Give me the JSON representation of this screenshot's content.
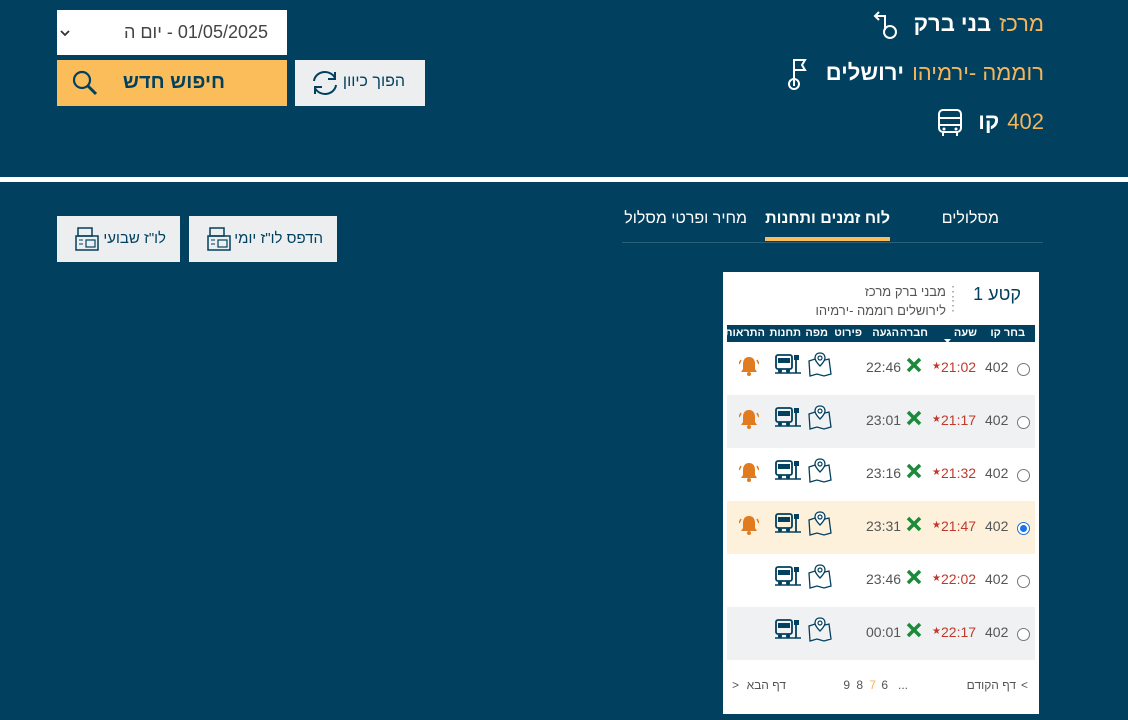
{
  "header": {
    "origin": {
      "city": "בני ברק",
      "stop": "מרכז"
    },
    "destination": {
      "city": "ירושלים",
      "stop": "רוממה -ירמיהו"
    },
    "line": {
      "label": "קו",
      "number": "402"
    },
    "date_select": {
      "value": "01/05/2025 - יום ה"
    },
    "search_button": "חיפוש חדש",
    "swap_button": "הפוך כיוון"
  },
  "tabs": [
    {
      "label": "מסלולים"
    },
    {
      "label": "לוח זמנים ותחנות"
    },
    {
      "label": "מחיר ופרטי מסלול"
    }
  ],
  "print_buttons": {
    "daily": "הדפס לו\"ז יומי",
    "weekly": "לו\"ז שבועי"
  },
  "segment": {
    "title": "קטע 1",
    "from": "מבני ברק מרכז",
    "to": "לירושלים רוממה -ירמיהו"
  },
  "table": {
    "headers": {
      "choose": "בחר קו",
      "time": "שעה",
      "operator": "חברה",
      "arrival": "הגעה",
      "details": "פירוט",
      "map": "מפה",
      "stations": "תחנות",
      "alerts": "התראות"
    },
    "rows": [
      {
        "line": "402",
        "dep": "21:02",
        "arr": "22:46",
        "bell": true
      },
      {
        "line": "402",
        "dep": "21:17",
        "arr": "23:01",
        "bell": true
      },
      {
        "line": "402",
        "dep": "21:32",
        "arr": "23:16",
        "bell": true
      },
      {
        "line": "402",
        "dep": "21:47",
        "arr": "23:31",
        "bell": true,
        "selected": true
      },
      {
        "line": "402",
        "dep": "22:02",
        "arr": "23:46",
        "bell": false
      },
      {
        "line": "402",
        "dep": "22:17",
        "arr": "00:01",
        "bell": false
      }
    ],
    "star": "★"
  },
  "pager": {
    "prev": "דף הקודם",
    "prev_arrow": "<",
    "pages": [
      "9",
      "8",
      "7",
      "6"
    ],
    "current": "7",
    "ellipsis": "...",
    "next": "דף הבא",
    "next_arrow": ">"
  },
  "colors": {
    "background": "#02405f",
    "accent": "#fbbd5a",
    "departure": "#c0392b",
    "bell": "#e07b1f",
    "operator": "#1b8a3a"
  }
}
